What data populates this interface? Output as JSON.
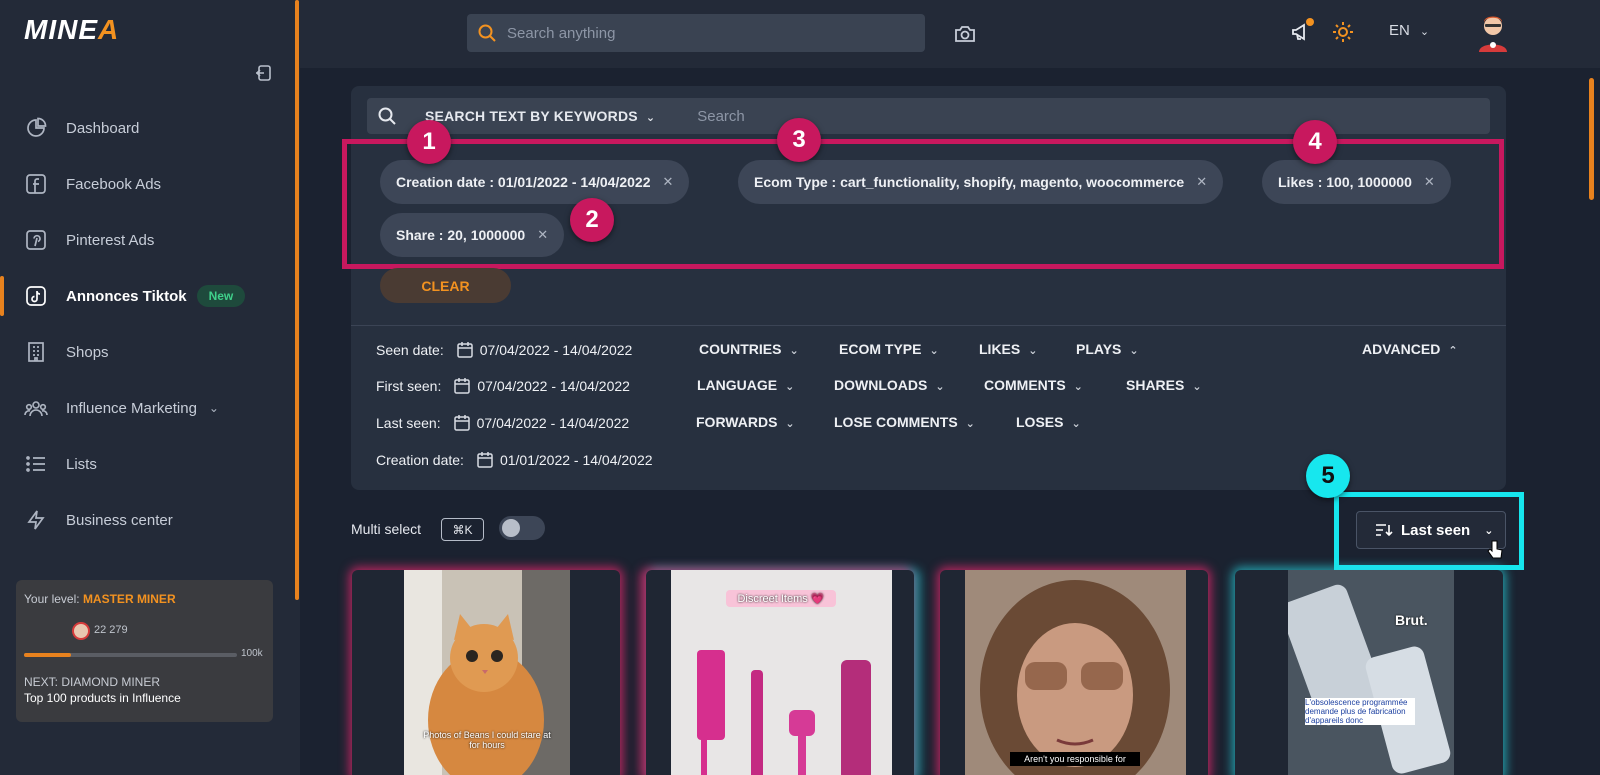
{
  "app": {
    "logo_main": "MINE",
    "logo_accent": "A"
  },
  "sidebar": {
    "items": [
      {
        "label": "Dashboard",
        "icon": "pie-chart-icon"
      },
      {
        "label": "Facebook Ads",
        "icon": "facebook-icon"
      },
      {
        "label": "Pinterest Ads",
        "icon": "pinterest-icon"
      },
      {
        "label": "Annonces Tiktok",
        "icon": "tiktok-icon",
        "active": true,
        "badge": "New"
      },
      {
        "label": "Shops",
        "icon": "building-icon"
      },
      {
        "label": "Influence Marketing",
        "icon": "users-icon",
        "expandable": true
      },
      {
        "label": "Lists",
        "icon": "list-icon"
      },
      {
        "label": "Business center",
        "icon": "lightning-icon"
      }
    ],
    "level": {
      "prefix": "Your level:",
      "name": "MASTER MINER",
      "points": "22 279",
      "max_label": "100k",
      "progress": 0.22,
      "next": "NEXT: DIAMOND MINER",
      "next_desc": "Top 100 products in Influence"
    }
  },
  "topbar": {
    "search_placeholder": "Search anything",
    "language": "EN"
  },
  "filters": {
    "keyword_mode": "SEARCH TEXT BY KEYWORDS",
    "keyword_placeholder": "Search",
    "chips": [
      "Creation date : 01/01/2022 - 14/04/2022",
      "Ecom Type : cart_functionality, shopify, magento, woocommerce",
      "Likes : 100, 1000000",
      "Share : 20, 1000000"
    ],
    "clear_label": "CLEAR",
    "rows": {
      "seen": {
        "label": "Seen date:",
        "date": "07/04/2022 - 14/04/2022"
      },
      "first": {
        "label": "First seen:",
        "date": "07/04/2022 - 14/04/2022"
      },
      "last": {
        "label": "Last seen:",
        "date": "07/04/2022 - 14/04/2022"
      },
      "creation": {
        "label": "Creation date:",
        "date": "01/01/2022 - 14/04/2022"
      }
    },
    "dropdowns": {
      "countries": "COUNTRIES",
      "ecom_type": "ECOM TYPE",
      "likes": "LIKES",
      "plays": "PLAYS",
      "advanced": "ADVANCED",
      "language": "LANGUAGE",
      "downloads": "DOWNLOADS",
      "comments": "COMMENTS",
      "shares": "SHARES",
      "forwards": "FORWARDS",
      "lose_comments": "LOSE COMMENTS",
      "loses": "LOSES"
    }
  },
  "annotations": [
    "1",
    "2",
    "3",
    "4",
    "5"
  ],
  "list_controls": {
    "multi_select": "Multi select",
    "shortcut": "⌘K",
    "sort_label": "Last seen"
  },
  "cards": [
    {
      "caption": "Photos of Beans I could stare at for hours"
    },
    {
      "caption": "Discreet Items 💗"
    },
    {
      "caption": "Aren't you responsible for"
    },
    {
      "caption": "Brut.",
      "subcaption": "L'obsolescence programmée demande plus de fabrication d'appareils donc"
    }
  ],
  "colors": {
    "accent": "#f39220",
    "annotation_pink": "#c8185e",
    "annotation_cyan": "#16e6ee",
    "new_badge": "#3fd08a"
  }
}
